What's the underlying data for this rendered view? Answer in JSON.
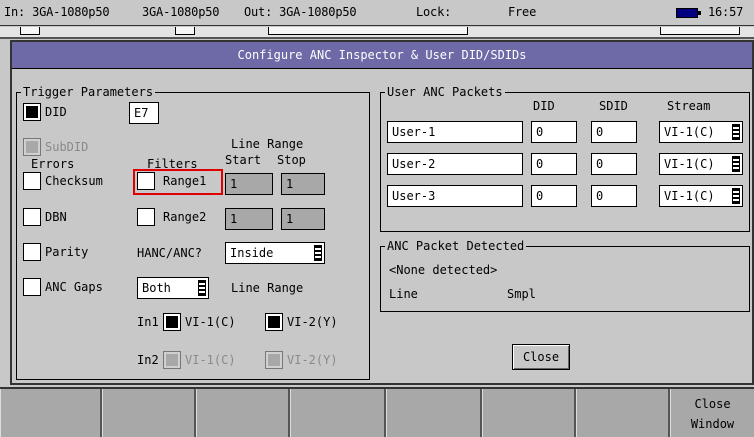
{
  "status_bar": {
    "in_label": "In: 3GA-1080p50",
    "in2_label": "3GA-1080p50",
    "out_label": "Out: 3GA-1080p50",
    "lock_label": "Lock:",
    "lock_value": "Free",
    "time": "16:57"
  },
  "dialog": {
    "title": "Configure ANC Inspector & User DID/SDIDs",
    "trigger": {
      "group_title": "Trigger Parameters",
      "did_label": "DID",
      "did_checked": true,
      "did_value": "E7",
      "subdid_label": "SubDID",
      "line_range_label": "Line Range",
      "errors_header": "Errors",
      "filters_header": "Filters",
      "start_header": "Start",
      "stop_header": "Stop",
      "checksum_label": "Checksum",
      "dbn_label": "DBN",
      "parity_label": "Parity",
      "anc_gaps_label": "ANC Gaps",
      "range1_label": "Range1",
      "range1_start": "1",
      "range1_stop": "1",
      "range2_label": "Range2",
      "range2_start": "1",
      "range2_stop": "1",
      "hanc_label": "HANC/ANC?",
      "hanc_value": "Inside",
      "both_value": "Both",
      "line_range2_label": "Line Range",
      "in1_label": "In1",
      "in1_opt1": "VI-1(C)",
      "in1_opt2": "VI-2(Y)",
      "in2_label": "In2",
      "in2_opt1": "VI-1(C)",
      "in2_opt2": "VI-2(Y)"
    },
    "user_anc": {
      "group_title": "User ANC Packets",
      "col_did": "DID",
      "col_sdid": "SDID",
      "col_stream": "Stream",
      "rows": [
        {
          "name": "User-1",
          "did": "0",
          "sdid": "0",
          "stream": "VI-1(C)"
        },
        {
          "name": "User-2",
          "did": "0",
          "sdid": "0",
          "stream": "VI-1(C)"
        },
        {
          "name": "User-3",
          "did": "0",
          "sdid": "0",
          "stream": "VI-1(C)"
        }
      ]
    },
    "detected": {
      "group_title": "ANC Packet Detected",
      "none_text": "<None detected>",
      "line_label": "Line",
      "smpl_label": "Smpl"
    },
    "close_label": "Close"
  },
  "softkeys": {
    "close_window_line1": "Close",
    "close_window_line2": "Window"
  },
  "colors": {
    "title_bar": "#6e6aa8",
    "selection_outline": "#e00000",
    "battery": "#000080"
  }
}
